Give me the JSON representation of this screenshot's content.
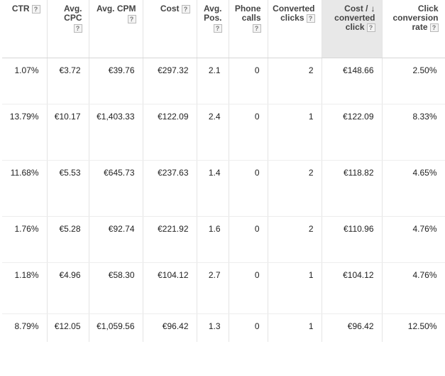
{
  "headers": [
    {
      "id": "ctr",
      "lines": [
        "CTR"
      ],
      "help": "?",
      "help_inline": true
    },
    {
      "id": "avg_cpc",
      "lines": [
        "Avg.",
        "CPC"
      ],
      "help": "?",
      "help_inline": false
    },
    {
      "id": "avg_cpm",
      "lines": [
        "Avg. CPM"
      ],
      "help": "?",
      "help_inline": false
    },
    {
      "id": "cost",
      "lines": [
        "Cost"
      ],
      "help": "?",
      "help_inline": true
    },
    {
      "id": "avg_pos",
      "lines": [
        "Avg.",
        "Pos."
      ],
      "help": "?",
      "help_inline": false
    },
    {
      "id": "phone_calls",
      "lines": [
        "Phone",
        "calls"
      ],
      "help": "?",
      "help_inline": false
    },
    {
      "id": "converted_clicks",
      "lines": [
        "Converted",
        "clicks"
      ],
      "help": "?",
      "help_inline": true
    },
    {
      "id": "cost_per_converted_click",
      "lines": [
        "Cost /",
        "converted",
        "click"
      ],
      "help": "?",
      "help_inline": true,
      "sort_icon": "↓"
    },
    {
      "id": "click_conversion_rate",
      "lines": [
        "Click",
        "conversion",
        "rate"
      ],
      "help": "?",
      "help_inline": true
    }
  ],
  "rows": [
    [
      "1.07%",
      "€3.72",
      "€39.76",
      "€297.32",
      "2.1",
      "0",
      "2",
      "€148.66",
      "2.50%"
    ],
    [
      "13.79%",
      "€10.17",
      "€1,403.33",
      "€122.09",
      "2.4",
      "0",
      "1",
      "€122.09",
      "8.33%"
    ],
    [
      "11.68%",
      "€5.53",
      "€645.73",
      "€237.63",
      "1.4",
      "0",
      "2",
      "€118.82",
      "4.65%"
    ],
    [
      "1.76%",
      "€5.28",
      "€92.74",
      "€221.92",
      "1.6",
      "0",
      "2",
      "€110.96",
      "4.76%"
    ],
    [
      "1.18%",
      "€4.96",
      "€58.30",
      "€104.12",
      "2.7",
      "0",
      "1",
      "€104.12",
      "4.76%"
    ],
    [
      "8.79%",
      "€12.05",
      "€1,059.56",
      "€96.42",
      "1.3",
      "0",
      "1",
      "€96.42",
      "12.50%"
    ]
  ],
  "colors": {
    "sorted_header_bg": "#e8e8e8",
    "grid_line": "#e4e4e4"
  }
}
